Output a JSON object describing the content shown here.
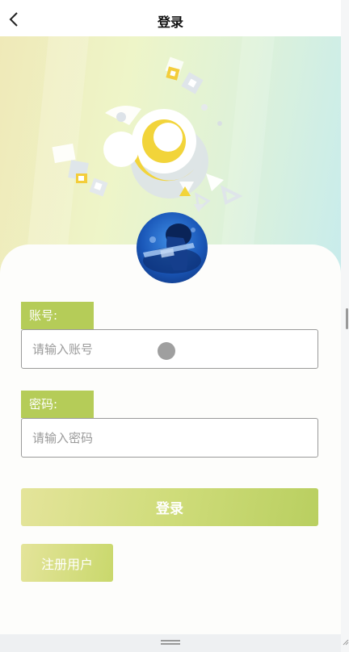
{
  "navbar": {
    "title": "登录",
    "back_icon": "chevron-left-icon"
  },
  "hero": {
    "illustration": "abstract-rings-and-triangles-illustration"
  },
  "avatar": {
    "description": "user-avatar"
  },
  "form": {
    "account_label": "账号:",
    "account_placeholder": "请输入账号",
    "password_label": "密码:",
    "password_placeholder": "请输入密码",
    "login_label": "登录",
    "register_label": "注册用户"
  },
  "colors": {
    "accent": "#b5cc58",
    "button_gradient_start": "#e4e49a",
    "button_gradient_end": "#b9cf60"
  }
}
